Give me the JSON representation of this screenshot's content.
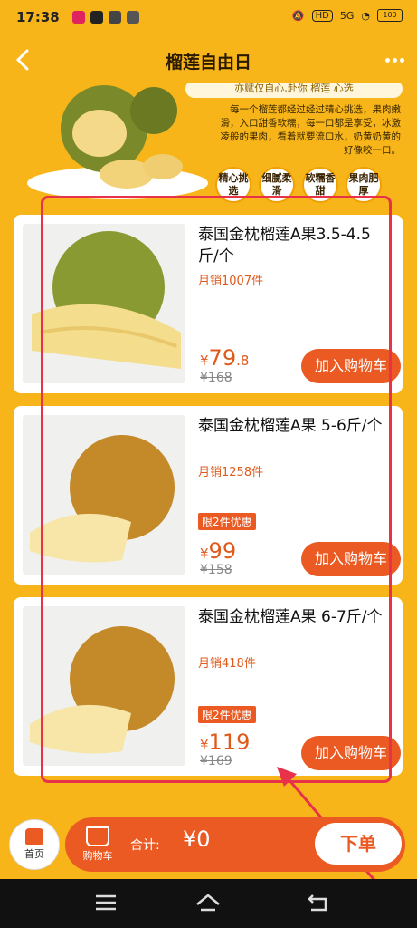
{
  "status": {
    "time": "17:38",
    "network": "5G",
    "hd": "HD",
    "battery": "100"
  },
  "nav": {
    "title": "榴莲自由日"
  },
  "banner": {
    "slogan": "亦赋仅自心,赴你 榴莲 心选",
    "desc": "每一个榴莲都经过经过精心挑选，果肉嫩滑，入口甜香软糯，每一口都是享受，冰激凌般的果肉，看着就要流口水，奶黄奶黄的好像咬一口。",
    "badges": [
      "精心挑选",
      "细腻柔滑",
      "软糯香甜",
      "果肉肥厚"
    ]
  },
  "products": [
    {
      "name": "泰国金枕榴莲A果3.5-4.5斤/个",
      "sales": "月销1007件",
      "promo": "",
      "currency": "¥",
      "price_int": "79",
      "price_dec": ".8",
      "original": "¥168",
      "cart": "加入购物车"
    },
    {
      "name": "泰国金枕榴莲A果 5-6斤/个",
      "sales": "月销1258件",
      "promo": "限2件优惠",
      "currency": "¥",
      "price_int": "99",
      "price_dec": "",
      "original": "¥158",
      "cart": "加入购物车"
    },
    {
      "name": "泰国金枕榴莲A果 6-7斤/个",
      "sales": "月销418件",
      "promo": "限2件优惠",
      "currency": "¥",
      "price_int": "119",
      "price_dec": "",
      "original": "¥169",
      "cart": "加入购物车"
    }
  ],
  "bottom": {
    "home": "首页",
    "cart": "购物车",
    "total_label": "合计:",
    "total_value": "¥0",
    "order": "下单"
  },
  "colors": {
    "background": "#f7b51a",
    "accent": "#ea5a22",
    "highlight": "#e8324a"
  }
}
